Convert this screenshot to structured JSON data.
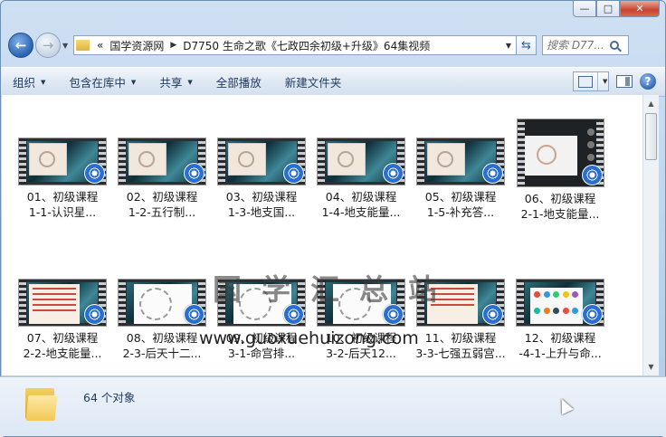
{
  "window": {
    "minimize_glyph": "—",
    "maximize_glyph": "□",
    "close_glyph": "✕"
  },
  "nav": {
    "back_glyph": "←",
    "forward_glyph": "→",
    "breadcrumb_overflow": "«",
    "breadcrumbs": [
      "国学资源网",
      "D7750 生命之歌《七政四余初级+升级》64集视频"
    ],
    "search_placeholder": "搜索 D77..."
  },
  "toolbar": {
    "organize": "组织",
    "include_in_library": "包含在库中",
    "share": "共享",
    "play_all": "全部播放",
    "new_folder": "新建文件夹",
    "help_glyph": "?"
  },
  "files": [
    {
      "line1": "01、初级课程",
      "line2": "1-1-认识星..."
    },
    {
      "line1": "02、初级课程",
      "line2": "1-2-五行制..."
    },
    {
      "line1": "03、初级课程",
      "line2": "1-3-地支国..."
    },
    {
      "line1": "04、初级课程",
      "line2": "1-4-地支能量..."
    },
    {
      "line1": "05、初级课程",
      "line2": "1-5-补充答..."
    },
    {
      "line1": "06、初级课程",
      "line2": "2-1-地支能量..."
    },
    {
      "line1": "07、初级课程",
      "line2": "2-2-地支能量..."
    },
    {
      "line1": "08、初级课程",
      "line2": "2-3-后天十二..."
    },
    {
      "line1": "09、初级课程",
      "line2": "3-1-命宫排..."
    },
    {
      "line1": "10、初级课程",
      "line2": "3-2-后天12..."
    },
    {
      "line1": "11、初级课程",
      "line2": "3-3-七强五弱宫..."
    },
    {
      "line1": "12、初级课程",
      "line2": "-4-1-上升与命..."
    }
  ],
  "watermark": {
    "text": "国学汇总站",
    "url": "www.guoxuehuizong.com"
  },
  "status": {
    "count": "64 个对象"
  }
}
